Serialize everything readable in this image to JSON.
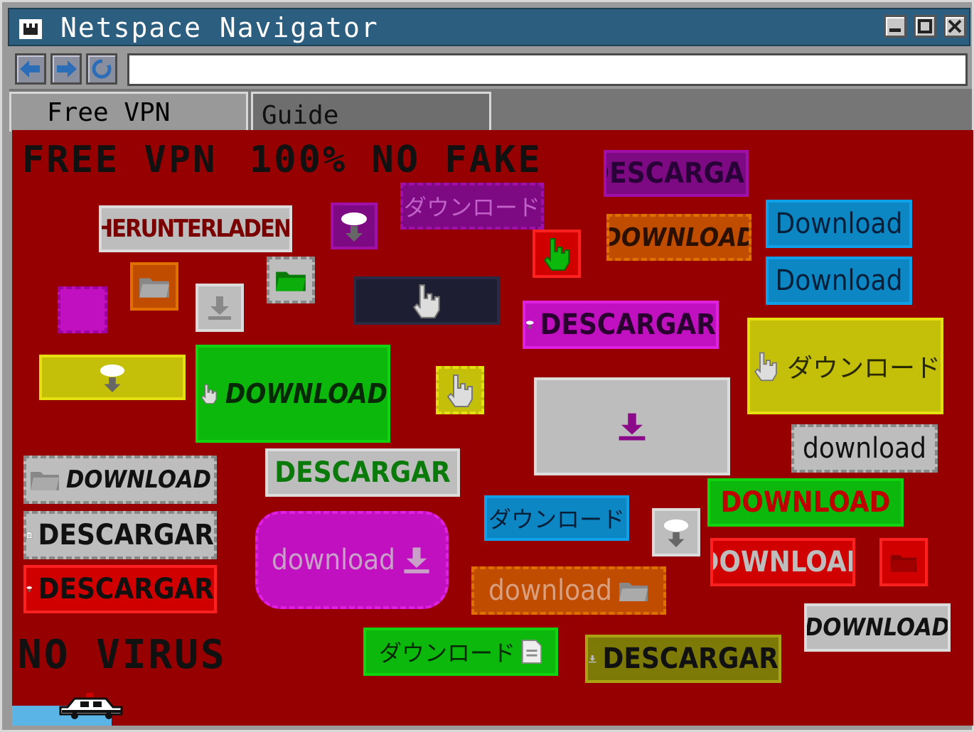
{
  "window": {
    "title": "Netspace Navigator"
  },
  "tabs": [
    {
      "label": "Free VPN"
    },
    {
      "label": "Guide"
    }
  ],
  "address": {
    "value": ""
  },
  "page": {
    "headline_left": "FREE VPN",
    "headline_right": "100% NO FAKE",
    "footer_text": "NO VIRUS"
  },
  "buttons": {
    "b01": "DESCARGAR",
    "b02": "ダウンロード",
    "b03": "HERUNTERLADEN",
    "b04": "DOWNLOAD",
    "b05": "Download",
    "b06": "Download",
    "b07": "DESCARGAR",
    "b08": "ダウンロード",
    "b09": "DOWNLOAD",
    "b10": "download",
    "b11": "DOWNLOAD",
    "b12": "DESCARGAR",
    "b13": "DOWNLOAD",
    "b14": "DESCARGAR",
    "b15": "DESCARGAR",
    "b16": "download",
    "b17": "ダウンロード",
    "b18": "DOWNLOAD",
    "b19": "download",
    "b20": "ダウンロード",
    "b21": "DESCARGAR",
    "b22": "DOWNLOAD"
  },
  "colors": {
    "titlebar": "#2c5e7f",
    "page_bg": "#960000",
    "purple": "#7d0a82",
    "orange": "#c04c00",
    "blue": "#0d86c4",
    "magenta": "#c010c0",
    "yellow": "#c4c00a",
    "green": "#0cb80c",
    "gray": "#bdbdbd"
  }
}
